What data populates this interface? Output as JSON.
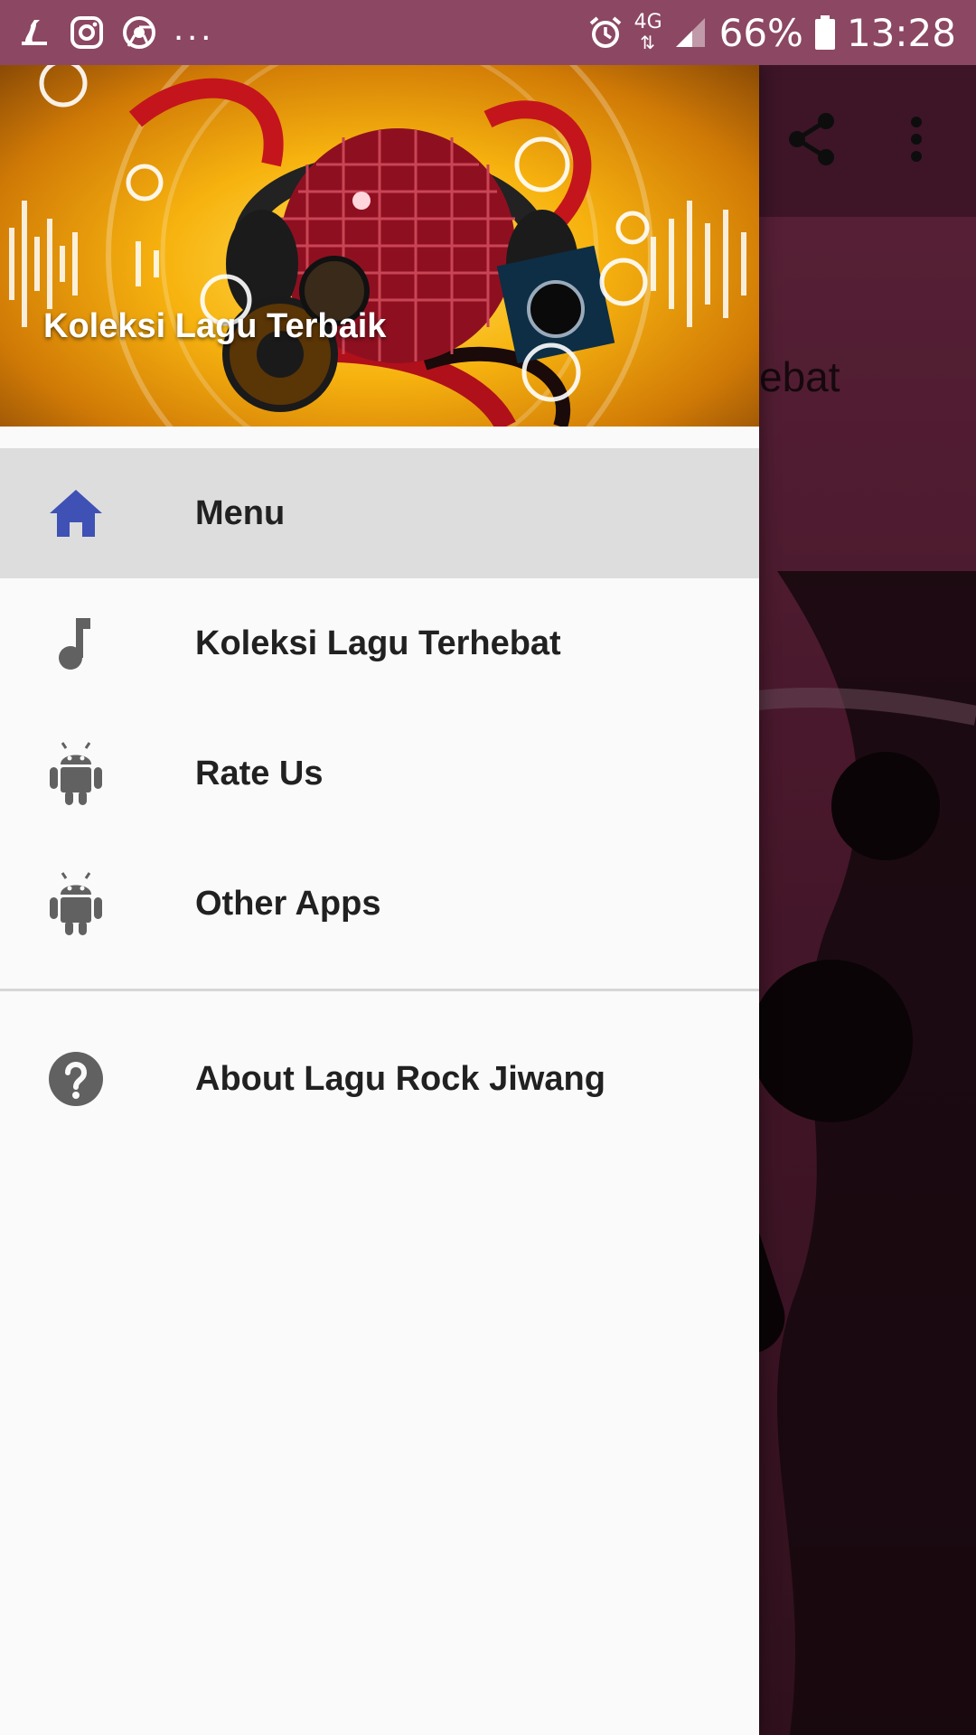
{
  "status_bar": {
    "more_indicator": "...",
    "network": "4G",
    "battery": "66%",
    "time": "13:28",
    "icons": [
      "notification-icon",
      "instagram-icon",
      "chrome-icon",
      "alarm-icon",
      "signal-icon",
      "battery-icon"
    ]
  },
  "drawer": {
    "header_title": "Koleksi Lagu Terbaik",
    "items": [
      {
        "label": "Menu",
        "icon": "home-icon",
        "active": true
      },
      {
        "label": "Koleksi Lagu Terhebat",
        "icon": "music-note-icon"
      },
      {
        "label": "Rate Us",
        "icon": "android-icon"
      },
      {
        "label": "Other Apps",
        "icon": "android-icon"
      },
      {
        "label": "About Lagu Rock Jiwang",
        "icon": "help-icon"
      }
    ]
  },
  "background": {
    "visible_title_fragment": "ebat",
    "actions": [
      "share-icon",
      "overflow-menu-icon"
    ]
  },
  "colors": {
    "status_bar": "#8c4762",
    "accent_icon": "#3f51b5",
    "icon_gray": "#616161",
    "active_item": "#dddddd"
  }
}
